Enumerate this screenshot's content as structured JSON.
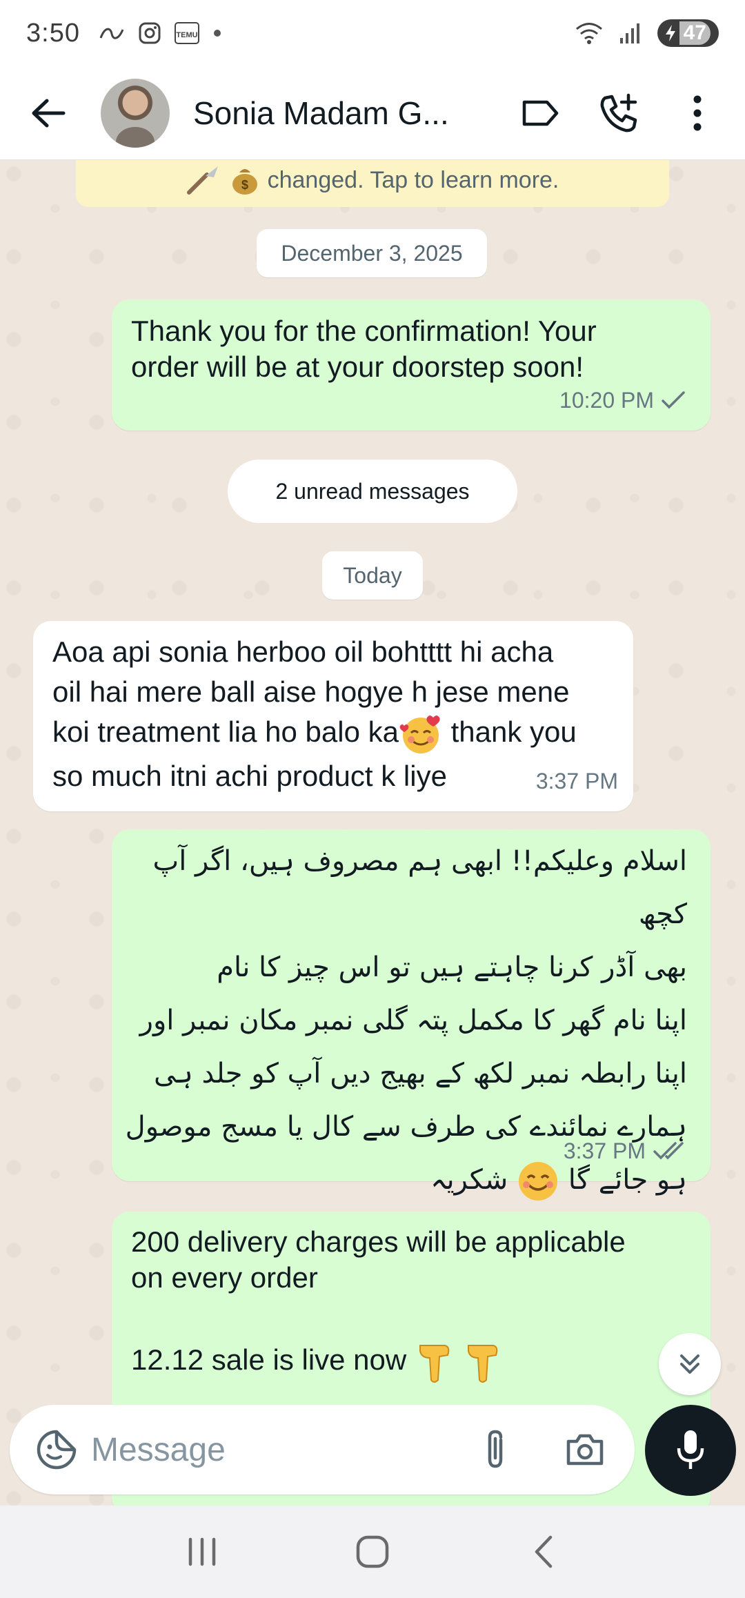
{
  "status_bar": {
    "time": "3:50",
    "battery": "47",
    "icons": [
      "swipe-icon",
      "instagram-icon",
      "temu-icon",
      "dot-icon",
      "wifi-icon",
      "signal-icon",
      "battery-icon"
    ]
  },
  "header": {
    "contact_name": "Sonia Madam G...",
    "icons": [
      "back-arrow-icon",
      "label-icon",
      "add-call-icon",
      "more-vert-icon"
    ]
  },
  "notice": {
    "text": "changed. Tap to learn more."
  },
  "chips": {
    "date1": "December 3, 2025",
    "unread": "2 unread messages",
    "date2": "Today"
  },
  "messages": [
    {
      "direction": "outgoing",
      "lines": [
        "Thank you for the confirmation! Your",
        "order will be at your doorstep soon!"
      ],
      "time": "10:20 PM",
      "status": "sent"
    },
    {
      "direction": "incoming",
      "lines": [
        "Aoa api sonia herboo oil bohtttt hi acha",
        "oil hai mere ball aise hogye h jese mene",
        "koi treatment lia ho balo ka",
        "thank you",
        "so much itni achi product k liye"
      ],
      "time": "3:37 PM"
    },
    {
      "direction": "outgoing",
      "lines": [
        "اسلام وعلیکم!! ابھی ہم مصروف ہیں، اگر آپ کچھ",
        "بھی آڈر کرنا چاہتے ہیں تو اس چیز کا نام",
        "اپنا نام گھر کا مکمل پتہ گلی نمبر مکان نمبر  اور",
        "اپنا رابطہ نمبر لکھ کے بھیج دیں آپ کو جلد ہی",
        "ہمارے نمائندے کی  طرف سے کال یا مسج موصول",
        "ہو جائے گا",
        "شکریہ"
      ],
      "time": "3:37 PM",
      "status": "delivered"
    },
    {
      "direction": "outgoing",
      "lines": [
        "200 delivery charges will be applicable",
        "on every order",
        "12.12 sale is live now"
      ]
    }
  ],
  "composer": {
    "placeholder": "Message"
  },
  "colors": {
    "outgoing_bubble": "#d9fdd3",
    "incoming_bubble": "#ffffff",
    "chat_bg": "#efe7dd",
    "mic_button": "#111b21"
  }
}
